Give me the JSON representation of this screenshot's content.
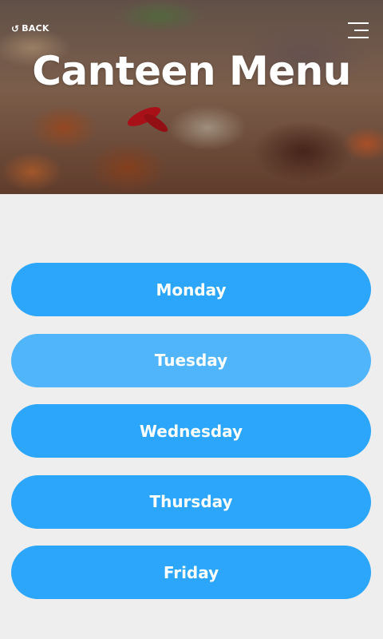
{
  "header": {
    "back_label": "BACK",
    "title": "Canteen Menu"
  },
  "icons": {
    "back": "undo-arrow-icon",
    "menu": "hamburger-menu-icon"
  },
  "days": [
    {
      "label": "Monday",
      "active": false
    },
    {
      "label": "Tuesday",
      "active": true
    },
    {
      "label": "Wednesday",
      "active": false
    },
    {
      "label": "Thursday",
      "active": false
    },
    {
      "label": "Friday",
      "active": false
    }
  ],
  "colors": {
    "button": "#2ba6fa",
    "button_active": "#51b5fb",
    "background": "#eeeeee",
    "text": "#ffffff"
  }
}
